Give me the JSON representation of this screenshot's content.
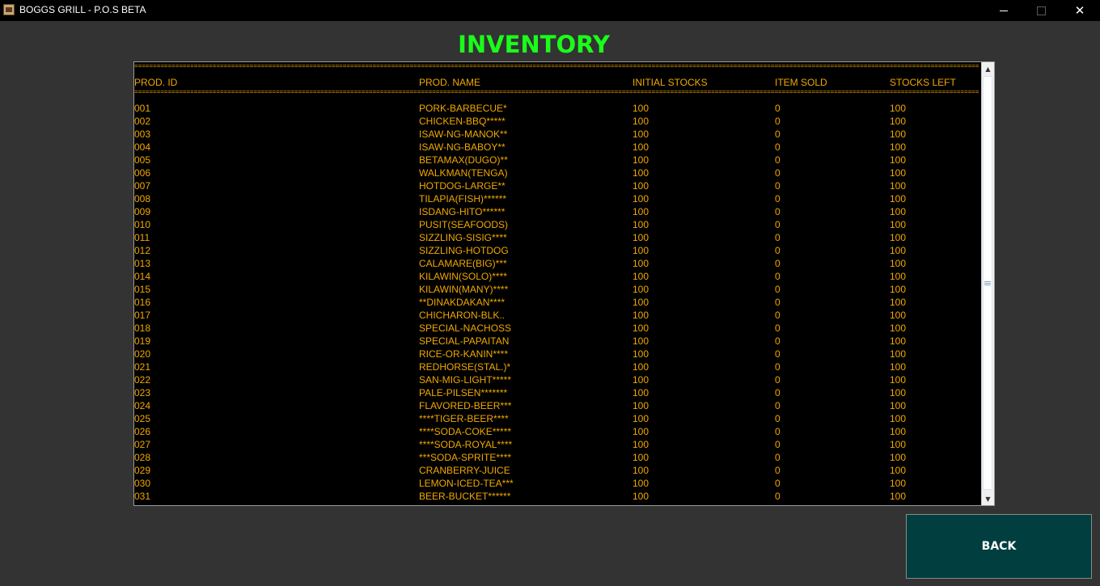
{
  "window": {
    "title": "BOGGS GRILL - P.O.S BETA",
    "icon": "app-logo-icon",
    "minimize_icon": "minimize-icon",
    "maximize_icon": "maximize-icon",
    "close_glyph": "✕"
  },
  "page": {
    "title": "INVENTORY",
    "title_color": "#1aff1a",
    "text_color": "#f0a800",
    "background": "#333333"
  },
  "inventory": {
    "separator": "===================================================================================================================================================================================================================================================",
    "columns": {
      "id": "PROD. ID",
      "name": "PROD. NAME",
      "initial": "INITIAL STOCKS",
      "sold": "ITEM SOLD",
      "left": "STOCKS LEFT"
    },
    "rows": [
      {
        "id": "001",
        "name": "PORK-BARBECUE*",
        "initial": "100",
        "sold": "0",
        "left": "100"
      },
      {
        "id": "002",
        "name": "CHICKEN-BBQ*****",
        "initial": "100",
        "sold": "0",
        "left": "100"
      },
      {
        "id": "003",
        "name": "ISAW-NG-MANOK**",
        "initial": "100",
        "sold": "0",
        "left": "100"
      },
      {
        "id": "004",
        "name": "ISAW-NG-BABOY**",
        "initial": "100",
        "sold": "0",
        "left": "100"
      },
      {
        "id": "005",
        "name": "BETAMAX(DUGO)**",
        "initial": "100",
        "sold": "0",
        "left": "100"
      },
      {
        "id": "006",
        "name": "WALKMAN(TENGA)",
        "initial": "100",
        "sold": "0",
        "left": "100"
      },
      {
        "id": "007",
        "name": "HOTDOG-LARGE**",
        "initial": "100",
        "sold": "0",
        "left": "100"
      },
      {
        "id": "008",
        "name": "TILAPIA(FISH)******",
        "initial": "100",
        "sold": "0",
        "left": "100"
      },
      {
        "id": "009",
        "name": "ISDANG-HITO******",
        "initial": "100",
        "sold": "0",
        "left": "100"
      },
      {
        "id": "010",
        "name": "PUSIT(SEAFOODS)",
        "initial": "100",
        "sold": "0",
        "left": "100"
      },
      {
        "id": "011",
        "name": "SIZZLING-SISIG****",
        "initial": "100",
        "sold": "0",
        "left": "100"
      },
      {
        "id": "012",
        "name": "SIZZLING-HOTDOG",
        "initial": "100",
        "sold": "0",
        "left": "100"
      },
      {
        "id": "013",
        "name": "CALAMARE(BIG)***",
        "initial": "100",
        "sold": "0",
        "left": "100"
      },
      {
        "id": "014",
        "name": "KILAWIN(SOLO)****",
        "initial": "100",
        "sold": "0",
        "left": "100"
      },
      {
        "id": "015",
        "name": "KILAWIN(MANY)****",
        "initial": "100",
        "sold": "0",
        "left": "100"
      },
      {
        "id": "016",
        "name": "**DINAKDAKAN****",
        "initial": "100",
        "sold": "0",
        "left": "100"
      },
      {
        "id": "017",
        "name": "CHICHARON-BLK..",
        "initial": "100",
        "sold": "0",
        "left": "100"
      },
      {
        "id": "018",
        "name": "SPECIAL-NACHOSS",
        "initial": "100",
        "sold": "0",
        "left": "100"
      },
      {
        "id": "019",
        "name": "SPECIAL-PAPAITAN",
        "initial": "100",
        "sold": "0",
        "left": "100"
      },
      {
        "id": "020",
        "name": "RICE-OR-KANIN****",
        "initial": "100",
        "sold": "0",
        "left": "100"
      },
      {
        "id": "021",
        "name": "REDHORSE(STAL.)*",
        "initial": "100",
        "sold": "0",
        "left": "100"
      },
      {
        "id": "022",
        "name": "SAN-MIG-LIGHT*****",
        "initial": "100",
        "sold": "0",
        "left": "100"
      },
      {
        "id": "023",
        "name": "PALE-PILSEN*******",
        "initial": "100",
        "sold": "0",
        "left": "100"
      },
      {
        "id": "024",
        "name": "FLAVORED-BEER***",
        "initial": "100",
        "sold": "0",
        "left": "100"
      },
      {
        "id": "025",
        "name": "****TIGER-BEER****",
        "initial": "100",
        "sold": "0",
        "left": "100"
      },
      {
        "id": "026",
        "name": "****SODA-COKE*****",
        "initial": "100",
        "sold": "0",
        "left": "100"
      },
      {
        "id": "027",
        "name": "****SODA-ROYAL****",
        "initial": "100",
        "sold": "0",
        "left": "100"
      },
      {
        "id": "028",
        "name": "***SODA-SPRITE****",
        "initial": "100",
        "sold": "0",
        "left": "100"
      },
      {
        "id": "029",
        "name": "CRANBERRY-JUICE",
        "initial": "100",
        "sold": "0",
        "left": "100"
      },
      {
        "id": "030",
        "name": "LEMON-ICED-TEA***",
        "initial": "100",
        "sold": "0",
        "left": "100"
      },
      {
        "id": "031",
        "name": "BEER-BUCKET******",
        "initial": "100",
        "sold": "0",
        "left": "100"
      }
    ]
  },
  "scrollbar": {
    "up_glyph": "▲",
    "down_glyph": "▼"
  },
  "actions": {
    "back_label": "BACK",
    "back_color": "#003e3f"
  }
}
